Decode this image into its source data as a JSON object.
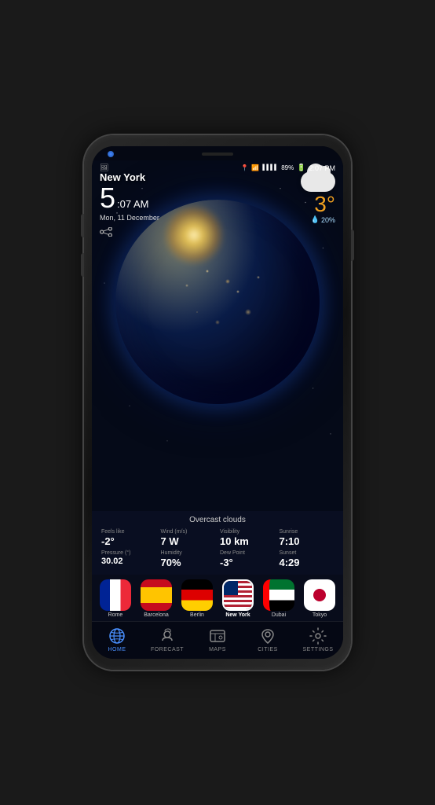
{
  "phone": {
    "statusBar": {
      "time": "2:07 PM",
      "battery": "89%",
      "signal": "●●●●",
      "wifi": true,
      "location": true
    },
    "weather": {
      "cityName": "New York",
      "timeHour": "5",
      "timeMinSuffix": ":07 AM",
      "date": "Mon, 11 December",
      "temperature": "3°",
      "temperatureUnit": "°",
      "precipitation": "20%",
      "condition": "Overcast clouds",
      "feelsLikeLabel": "Feels like",
      "feelsLikeValue": "-2°",
      "windLabel": "Wind (m/s)",
      "windValue": "7 W",
      "visibilityLabel": "Visibility",
      "visibilityValue": "10 km",
      "sunriseLabel": "Sunrise",
      "sunriseValue": "7:10",
      "pressureLabel": "Pressure (°)",
      "pressureValue": "30.02",
      "humidityLabel": "Humidity",
      "humidityValue": "70%",
      "dewPointLabel": "Dew Point",
      "dewPointValue": "-3°",
      "sunsetLabel": "Sunset",
      "sunsetValue": "4:29"
    },
    "cities": [
      {
        "id": "rome",
        "label": "Rome",
        "flag": "france",
        "active": false
      },
      {
        "id": "barcelona",
        "label": "Barcelona",
        "flag": "spain",
        "active": false
      },
      {
        "id": "berlin",
        "label": "Berlin",
        "flag": "germany",
        "active": false
      },
      {
        "id": "newyork",
        "label": "New York",
        "flag": "usa",
        "active": true
      },
      {
        "id": "dubai",
        "label": "Dubai",
        "flag": "uae",
        "active": false
      },
      {
        "id": "tokyo",
        "label": "Tokyo",
        "flag": "japan",
        "active": false
      }
    ],
    "nav": [
      {
        "id": "home",
        "label": "HOME",
        "active": true
      },
      {
        "id": "forecast",
        "label": "FORECAST",
        "active": false
      },
      {
        "id": "maps",
        "label": "MAPS",
        "active": false
      },
      {
        "id": "cities",
        "label": "CITIES",
        "active": false
      },
      {
        "id": "settings",
        "label": "SETTINGS",
        "active": false
      }
    ]
  }
}
